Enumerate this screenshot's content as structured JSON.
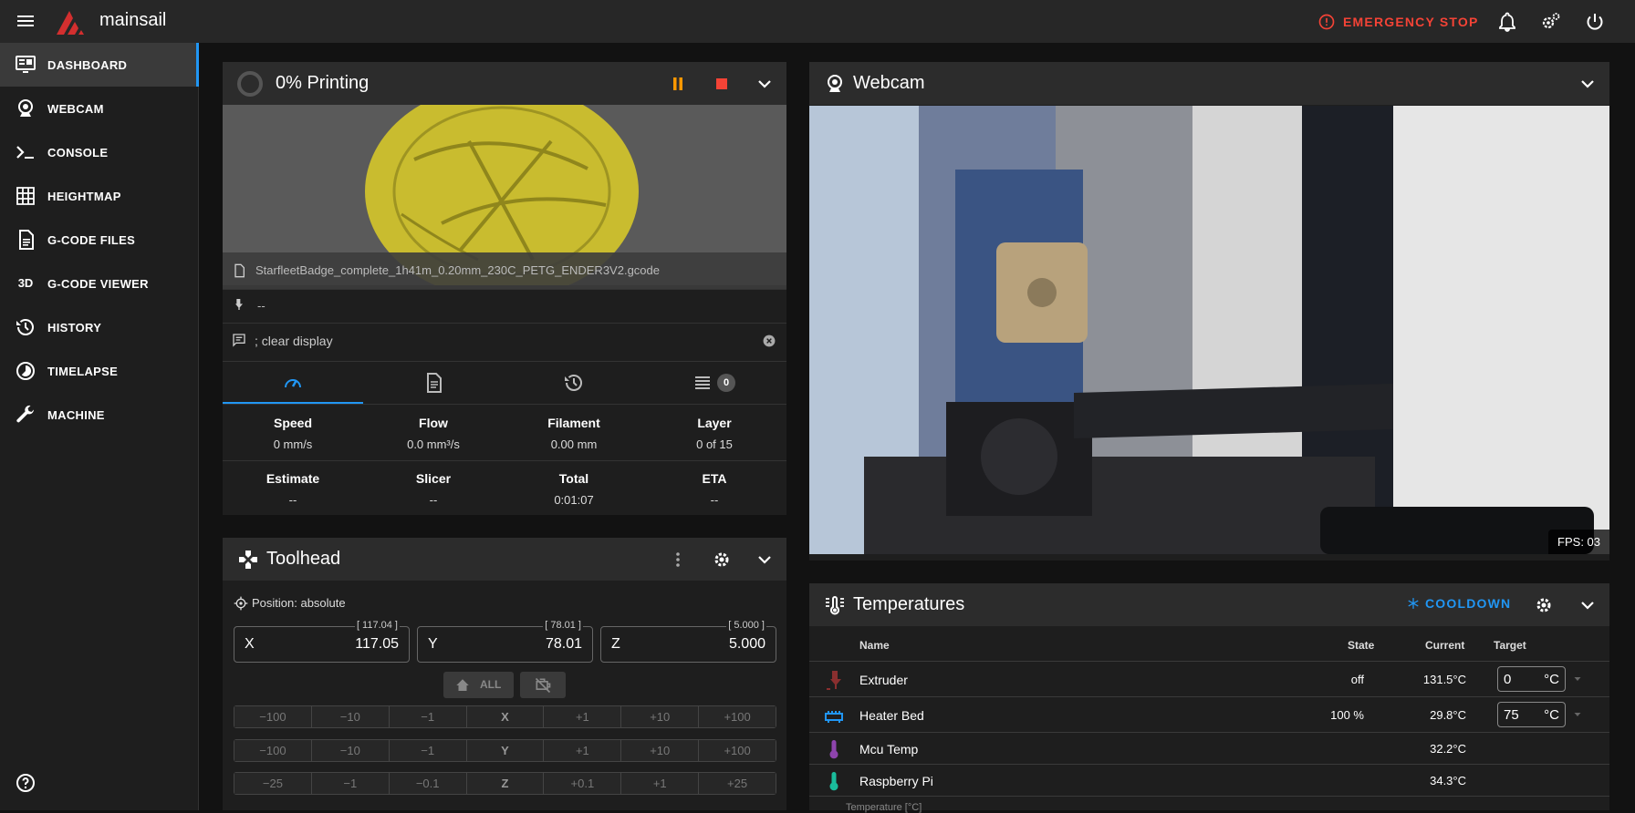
{
  "app": {
    "brand": "mainsail",
    "emergency_stop": "EMERGENCY STOP"
  },
  "sidebar": {
    "items": [
      {
        "label": "DASHBOARD",
        "icon": "dashboard-icon"
      },
      {
        "label": "WEBCAM",
        "icon": "webcam-icon"
      },
      {
        "label": "CONSOLE",
        "icon": "console-icon"
      },
      {
        "label": "HEIGHTMAP",
        "icon": "grid-icon"
      },
      {
        "label": "G-CODE FILES",
        "icon": "file-icon"
      },
      {
        "label": "G-CODE VIEWER",
        "icon": "3d-icon"
      },
      {
        "label": "HISTORY",
        "icon": "history-icon"
      },
      {
        "label": "TIMELAPSE",
        "icon": "timelapse-icon"
      },
      {
        "label": "MACHINE",
        "icon": "wrench-icon"
      }
    ],
    "icon_3d_text": "3D"
  },
  "status": {
    "title": "0% Printing",
    "filename": "StarfleetBadge_complete_1h41m_0.20mm_230C_PETG_ENDER3V2.gcode",
    "filament_sensor": "--",
    "message": "; clear display",
    "queue_count": "0",
    "stats_row1": [
      {
        "label": "Speed",
        "value": "0 mm/s"
      },
      {
        "label": "Flow",
        "value": "0.0 mm³/s"
      },
      {
        "label": "Filament",
        "value": "0.00 mm"
      },
      {
        "label": "Layer",
        "value": "0 of 15"
      }
    ],
    "stats_row2": [
      {
        "label": "Estimate",
        "value": "--"
      },
      {
        "label": "Slicer",
        "value": "--"
      },
      {
        "label": "Total",
        "value": "0:01:07"
      },
      {
        "label": "ETA",
        "value": "--"
      }
    ]
  },
  "toolhead": {
    "title": "Toolhead",
    "position_mode": "Position: absolute",
    "x": {
      "axis": "X",
      "value": "117.05",
      "hint": "[ 117.04 ]"
    },
    "y": {
      "axis": "Y",
      "value": "78.01",
      "hint": "[ 78.01 ]"
    },
    "z": {
      "axis": "Z",
      "value": "5.000",
      "hint": "[ 5.000 ]"
    },
    "home_all": "ALL",
    "jog_rows": [
      [
        "−100",
        "−10",
        "−1",
        "X",
        "+1",
        "+10",
        "+100"
      ],
      [
        "−100",
        "−10",
        "−1",
        "Y",
        "+1",
        "+10",
        "+100"
      ],
      [
        "−25",
        "−1",
        "−0.1",
        "Z",
        "+0.1",
        "+1",
        "+25"
      ]
    ]
  },
  "webcam": {
    "title": "Webcam",
    "fps": "FPS: 03"
  },
  "temperatures": {
    "title": "Temperatures",
    "cooldown": "COOLDOWN",
    "headers": {
      "name": "Name",
      "state": "State",
      "current": "Current",
      "target": "Target"
    },
    "rows": [
      {
        "name": "Extruder",
        "state": "off",
        "current": "131.5°C",
        "target": "0",
        "unit": "°C"
      },
      {
        "name": "Heater Bed",
        "state": "100 %",
        "current": "29.8°C",
        "target": "75",
        "unit": "°C"
      },
      {
        "name": "Mcu Temp",
        "state": "",
        "current": "32.2°C"
      },
      {
        "name": "Raspberry Pi",
        "state": "",
        "current": "34.3°C"
      }
    ],
    "chart_label": "Temperature [°C]"
  },
  "colors": {
    "accent": "#2196f3",
    "danger": "#f44336",
    "pause": "#ff9800",
    "badge_yellow": "#c9bc2f"
  }
}
